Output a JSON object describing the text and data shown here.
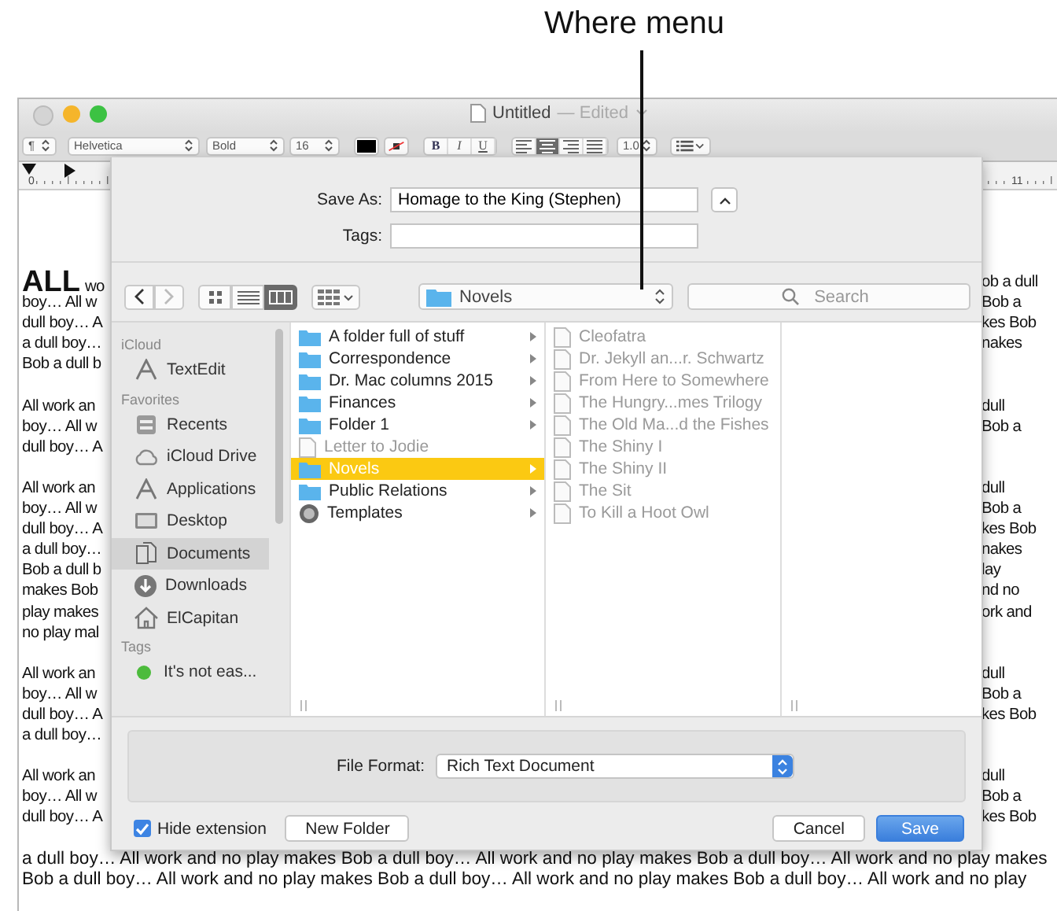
{
  "callout": {
    "label": "Where menu"
  },
  "window": {
    "title": "Untitled",
    "status": "— Edited"
  },
  "format_bar": {
    "paragraph_styles": "¶",
    "font_family": "Helvetica",
    "typeface": "Bold",
    "font_size": "16",
    "bold": "B",
    "italic": "I",
    "underline": "U",
    "alignment": [
      {
        "selected": false
      },
      {
        "selected": true
      },
      {
        "selected": false
      },
      {
        "selected": false
      }
    ],
    "line_spacing": "1.0"
  },
  "ruler": {
    "start": "0",
    "end": "11"
  },
  "document": {
    "paragraphs": [
      {
        "lines": [
          {
            "lead": "ALL",
            "left": "wo",
            "right": "ob a dull"
          },
          {
            "left": "boy… All w",
            "right": "Bob a"
          },
          {
            "left": "dull boy… A",
            "right": "kes Bob"
          },
          {
            "left": "a dull boy…",
            "right": "nakes"
          },
          {
            "left": "Bob a dull b"
          }
        ]
      },
      {
        "lines": [
          {
            "left": "All work an",
            "right": "dull"
          },
          {
            "left": "boy… All w",
            "right": "Bob a"
          },
          {
            "left": "dull boy… A"
          }
        ]
      },
      {
        "lines": [
          {
            "left": "All work an",
            "right": "dull"
          },
          {
            "left": "boy… All w",
            "right": "Bob a"
          },
          {
            "left": "dull boy… A",
            "right": "kes Bob"
          },
          {
            "left": "a dull boy…",
            "right": "nakes"
          },
          {
            "left": "Bob a dull b",
            "right": "lay"
          },
          {
            "left": "makes Bob",
            "right": "nd no"
          },
          {
            "left": "play makes",
            "right": "ork and"
          },
          {
            "left": "no play mal"
          }
        ]
      },
      {
        "lines": [
          {
            "left": "All work an",
            "right": "dull"
          },
          {
            "left": "boy… All w",
            "right": "Bob a"
          },
          {
            "left": "dull boy… A",
            "right": "kes Bob"
          },
          {
            "left": "a dull boy…"
          }
        ]
      },
      {
        "lines": [
          {
            "left": "All work an",
            "right": "dull"
          },
          {
            "left": "boy… All w",
            "right": "Bob a"
          },
          {
            "left": "dull boy… A",
            "right": "kes Bob"
          }
        ]
      }
    ],
    "full_lines": [
      "a dull boy… All work and no play makes Bob a dull boy… All work and no play makes Bob a dull boy… All work and no play makes",
      "Bob a dull boy… All work and no play makes Bob a dull boy… All work and no play makes Bob a dull boy… All work and no play"
    ]
  },
  "save_sheet": {
    "save_as": {
      "label": "Save As:",
      "value": "Homage to the King (Stephen)"
    },
    "tags": {
      "label": "Tags:"
    },
    "view_modes": [
      {
        "kind": "icons",
        "selected": false
      },
      {
        "kind": "list",
        "selected": false
      },
      {
        "kind": "columns",
        "selected": true
      }
    ],
    "location": {
      "label": "Novels"
    },
    "search": {
      "placeholder": "Search"
    },
    "sidebar": {
      "sections": [
        {
          "title": "iCloud",
          "items": [
            {
              "label": "TextEdit",
              "kind": "app",
              "selected": false
            }
          ]
        },
        {
          "title": "Favorites",
          "items": [
            {
              "label": "Recents",
              "kind": "recents",
              "selected": false
            },
            {
              "label": "iCloud Drive",
              "kind": "cloud",
              "selected": false
            },
            {
              "label": "Applications",
              "kind": "app",
              "selected": false
            },
            {
              "label": "Desktop",
              "kind": "desktop",
              "selected": false
            },
            {
              "label": "Documents",
              "kind": "documents",
              "selected": true
            },
            {
              "label": "Downloads",
              "kind": "downloads",
              "selected": false
            },
            {
              "label": "ElCapitan",
              "kind": "home",
              "selected": false
            }
          ]
        },
        {
          "title": "Tags",
          "items": [
            {
              "label": "It's not eas...",
              "kind": "tag",
              "color": "#4cbb3c",
              "selected": false
            }
          ]
        }
      ]
    },
    "columns": [
      {
        "items": [
          {
            "label": "A folder full of stuff",
            "kind": "folder",
            "selected": false,
            "disabled": false
          },
          {
            "label": "Correspondence",
            "kind": "folder",
            "selected": false,
            "disabled": false
          },
          {
            "label": "Dr. Mac columns 2015",
            "kind": "folder",
            "selected": false,
            "disabled": false
          },
          {
            "label": "Finances",
            "kind": "folder",
            "selected": false,
            "disabled": false
          },
          {
            "label": "Folder 1",
            "kind": "folder",
            "selected": false,
            "disabled": false
          },
          {
            "label": "Letter to Jodie",
            "kind": "file",
            "selected": false,
            "disabled": true
          },
          {
            "label": "Novels",
            "kind": "folder",
            "selected": true,
            "disabled": false
          },
          {
            "label": "Public Relations",
            "kind": "folder",
            "selected": false,
            "disabled": false
          },
          {
            "label": "Templates",
            "kind": "templates",
            "selected": false,
            "disabled": false
          }
        ]
      },
      {
        "items": [
          {
            "label": "Cleofatra",
            "kind": "file",
            "selected": false,
            "disabled": true
          },
          {
            "label": "Dr. Jekyll an...r. Schwartz",
            "kind": "file",
            "selected": false,
            "disabled": true
          },
          {
            "label": "From Here to Somewhere",
            "kind": "file",
            "selected": false,
            "disabled": true
          },
          {
            "label": "The Hungry...mes Trilogy",
            "kind": "file",
            "selected": false,
            "disabled": true
          },
          {
            "label": "The Old Ma...d the Fishes",
            "kind": "file",
            "selected": false,
            "disabled": true
          },
          {
            "label": "The Shiny I",
            "kind": "file",
            "selected": false,
            "disabled": true
          },
          {
            "label": "The Shiny II",
            "kind": "file",
            "selected": false,
            "disabled": true
          },
          {
            "label": "The Sit",
            "kind": "file",
            "selected": false,
            "disabled": true
          },
          {
            "label": "To Kill a Hoot Owl",
            "kind": "file",
            "selected": false,
            "disabled": true
          }
        ]
      }
    ],
    "file_format": {
      "label": "File Format:",
      "value": "Rich Text Document"
    },
    "hide_extension": {
      "label": "Hide extension",
      "checked": true
    },
    "new_folder_button": {
      "label": "New Folder"
    },
    "buttons": [
      {
        "label": "Cancel",
        "default": false
      },
      {
        "label": "Save",
        "default": true
      }
    ]
  }
}
